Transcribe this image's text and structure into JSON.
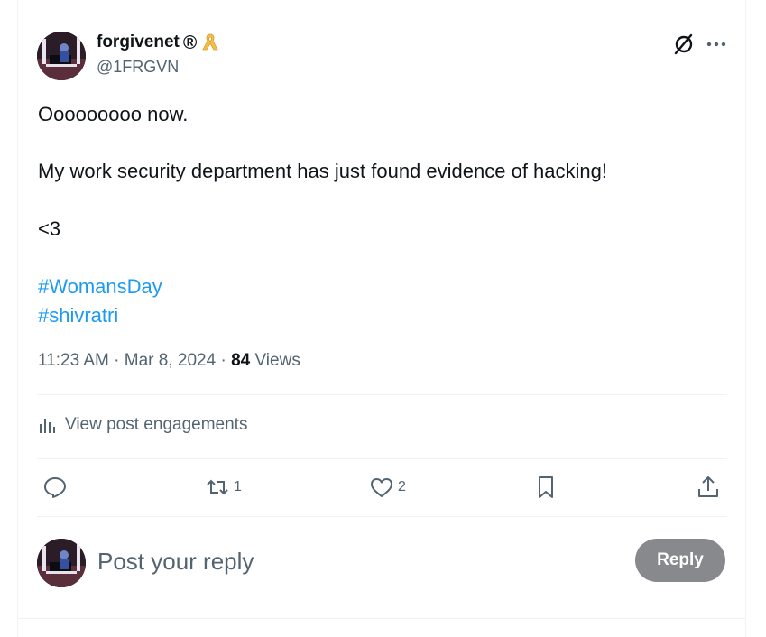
{
  "colors": {
    "text_primary": "#0f1419",
    "text_secondary": "#536471",
    "link": "#1d9bf0",
    "divider": "#eff3f4",
    "reply_button_bg": "#87898c",
    "ribbon": "#f5bf4f"
  },
  "author": {
    "display_name": "forgivenet",
    "registered_mark": "®",
    "badge_icon": "yellow-ribbon-icon",
    "handle": "@1FRGVN",
    "avatar_icon": "profile-avatar"
  },
  "header_actions": {
    "grok_icon": "grok-icon",
    "more_icon": "more-dots-icon"
  },
  "tweet": {
    "lines": [
      "Ooooooooo now.",
      "My work security department has just found evidence of hacking!",
      "<3"
    ],
    "hashtags": [
      "#WomansDay",
      "#shivratri"
    ],
    "time": "11:23 AM",
    "separator": " · ",
    "date": "Mar 8, 2024",
    "views_count": "84",
    "views_label": " Views"
  },
  "engagements": {
    "icon": "analytics-bars-icon",
    "label": "View post engagements"
  },
  "actions": {
    "reply": {
      "icon": "reply-bubble-icon",
      "count": ""
    },
    "repost": {
      "icon": "repost-icon",
      "count": "1"
    },
    "like": {
      "icon": "heart-icon",
      "count": "2"
    },
    "bookmark": {
      "icon": "bookmark-icon",
      "count": ""
    },
    "share": {
      "icon": "share-upload-icon",
      "count": ""
    }
  },
  "reply_box": {
    "placeholder": "Post your reply",
    "value": "",
    "button_label": "Reply"
  }
}
